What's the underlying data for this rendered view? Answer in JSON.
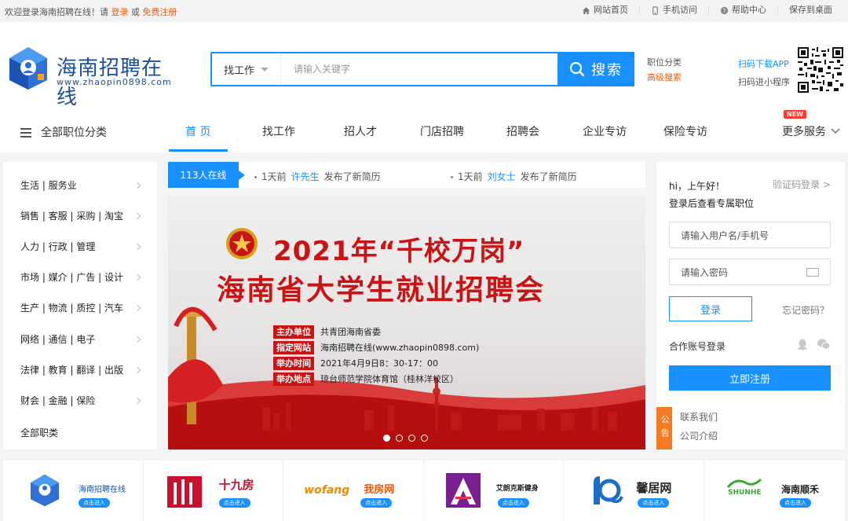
{
  "topbar": {
    "welcome_prefix": "欢迎登录海南招聘在线！请",
    "login": "登录",
    "or": "或",
    "register": "免费注册",
    "links": [
      "网站首页",
      "手机访问",
      "帮助中心",
      "保存到桌面"
    ]
  },
  "header": {
    "site_name": "海南招聘在线",
    "site_url": "www.zhaopin0898.com",
    "search_type": "找工作",
    "search_placeholder": "请输入关键字",
    "search_button": "搜索",
    "job_category": "职位分类",
    "advanced_search": "高级搜索",
    "download_app": "扫码下载APP",
    "mini_program": "扫码进小程序"
  },
  "nav": {
    "all_categories": "全部职位分类",
    "tabs": [
      "首 页",
      "找工作",
      "招人才",
      "门店招聘",
      "招聘会",
      "企业专访",
      "保险专访"
    ],
    "more": "更多服务",
    "new_badge": "NEW"
  },
  "categories": [
    "生活 | 服务业",
    "销售 | 客服 | 采购 | 淘宝",
    "人力 | 行政 | 管理",
    "市场 | 媒介 | 广告 | 设计",
    "生产 | 物流 | 质控 | 汽车",
    "网络 | 通信 | 电子",
    "法律 | 教育 | 翻译 | 出版",
    "财会 | 金融 | 保险",
    "全部职类"
  ],
  "ticker": {
    "online": "113人在线",
    "messages": [
      {
        "time": "1天前",
        "who": "许先生",
        "action": "发布了新简历"
      },
      {
        "time": "1天前",
        "who": "刘女士",
        "action": "发布了新简历"
      }
    ]
  },
  "banner": {
    "headline1": "2021年“千校万岗”",
    "headline2": "海南省大学生就业招聘会",
    "rows": [
      {
        "label": "主办单位",
        "value": "共青团海南省委"
      },
      {
        "label": "指定网站",
        "value": "海南招聘在线(www.zhaopin0898.com)"
      },
      {
        "label": "举办时间",
        "value": "2021年4月9日8：30-17：00"
      },
      {
        "label": "举办地点",
        "value": "琼台师范学院体育馆（桂林洋校区）"
      }
    ],
    "slide_count": 4,
    "active_slide": 1
  },
  "login": {
    "greeting": "hi，上午好！",
    "subtitle": "登录后查看专属职位",
    "code_login": "验证码登录 >",
    "username_placeholder": "请输入用户名/手机号",
    "password_placeholder": "请输入密码",
    "login_button": "登录",
    "forgot": "忘记密码？",
    "partner_login": "合作账号登录",
    "register_button": "立即注册"
  },
  "notice": {
    "tag": "公告",
    "items": [
      "联系我们",
      "公司介绍"
    ]
  },
  "partners": [
    {
      "name": "海南招聘在线",
      "button": "点击进入"
    },
    {
      "name": "十九房",
      "button": "点击进入"
    },
    {
      "name": "我房网",
      "button": "点击进入",
      "logo_text": "wofang"
    },
    {
      "name": "艾朗克斯健身",
      "button": "点击进入"
    },
    {
      "name": "馨居网",
      "button": "点击进入"
    },
    {
      "name": "海南顺禾",
      "button": "点击进入",
      "logo_text": "SHUNHE"
    }
  ],
  "colors": {
    "primary": "#1890ff",
    "accent_orange": "#e85d0c",
    "banner_red": "#c81414",
    "notice_orange": "#f47b24"
  }
}
